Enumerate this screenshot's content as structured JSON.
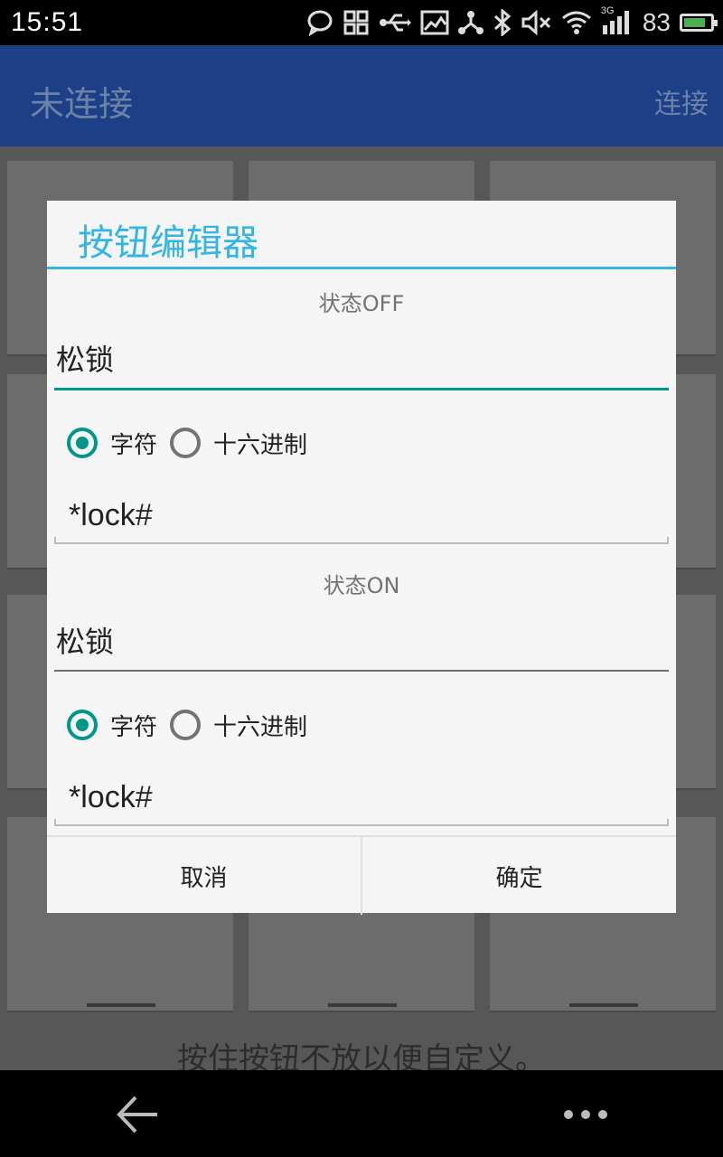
{
  "status_bar": {
    "time": "15:51",
    "network": "3G",
    "battery_percent": "83",
    "battery_level": 0.83,
    "icons": [
      "chat-bubble-icon",
      "grid-icon",
      "usb-icon",
      "image-icon",
      "share-icon",
      "bluetooth-icon",
      "mute-icon",
      "wifi-icon",
      "signal-icon",
      "battery-icon"
    ]
  },
  "app_bar": {
    "title": "未连接",
    "action_label": "连接"
  },
  "grid": {
    "hint": "按住按钮不放以便自定义。"
  },
  "dialog": {
    "title": "按钮编辑器",
    "state_off": {
      "label": "状态OFF",
      "name_value": "松锁",
      "radio_char_label": "字符",
      "radio_hex_label": "十六进制",
      "selected": "字符",
      "command_value": "*lock#"
    },
    "state_on": {
      "label": "状态ON",
      "name_value": "松锁",
      "radio_char_label": "字符",
      "radio_hex_label": "十六进制",
      "selected": "字符",
      "command_value": "*lock#"
    },
    "cancel_label": "取消",
    "ok_label": "确定"
  },
  "colors": {
    "accent": "#009688",
    "title_blue": "#33b5e5",
    "app_bar": "#1c3f86"
  }
}
